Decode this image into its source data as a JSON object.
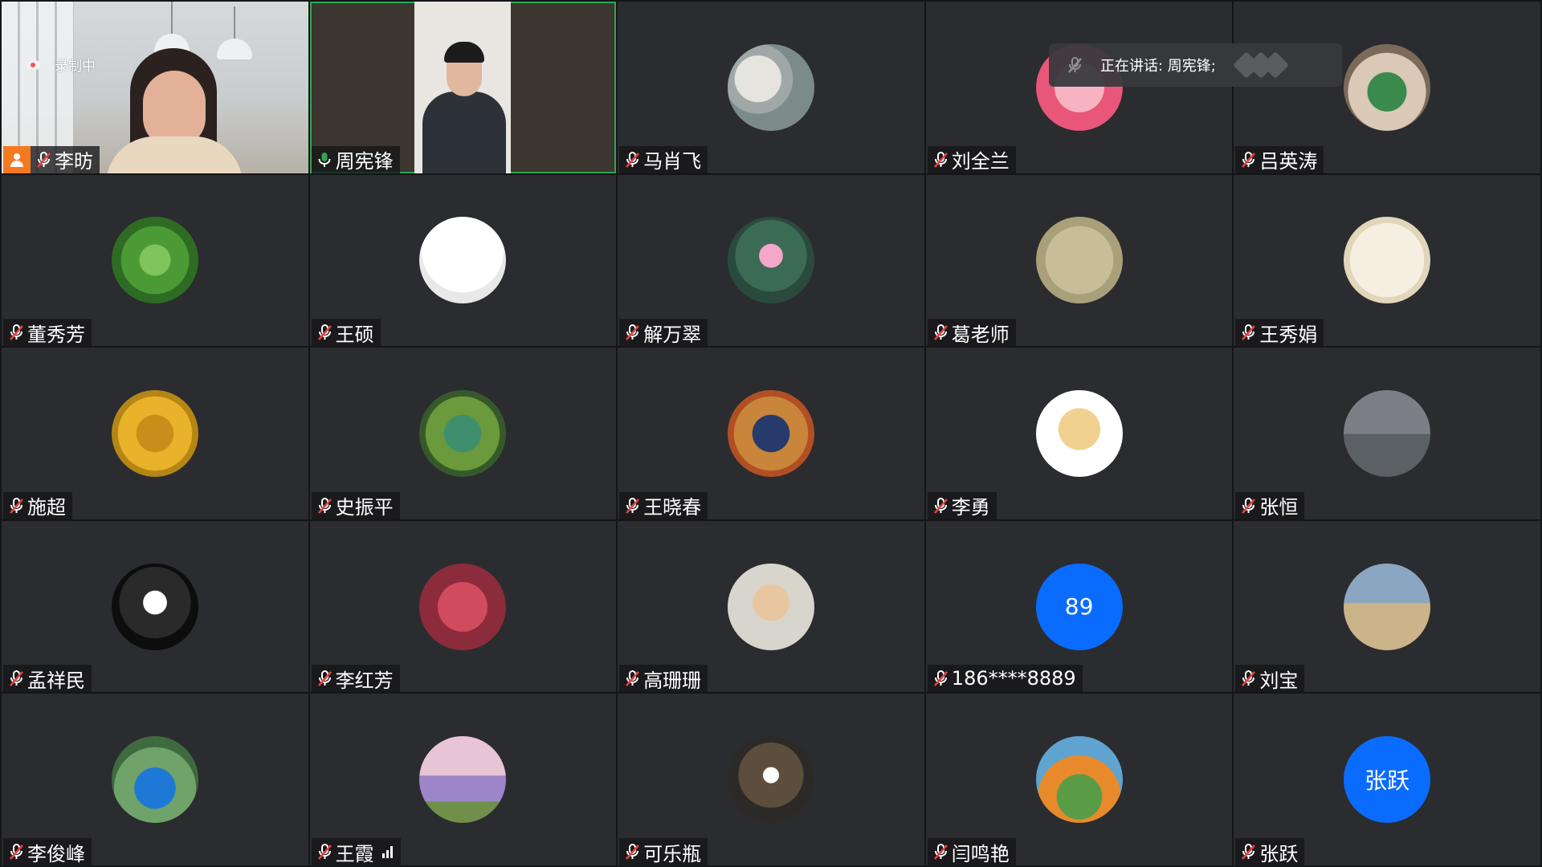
{
  "meeting": {
    "recording_label": "录制中",
    "speaking_label": "正在讲话: 周宪锋;",
    "colors": {
      "tile_bg": "#2b2c2f",
      "active_border": "#2ea652",
      "host_badge": "#f4791f",
      "mic_active": "#2ea652",
      "text_avatar": "#0a6cff"
    }
  },
  "participants": [
    {
      "name": "李昉",
      "kind": "video-office",
      "host": true,
      "muted": true
    },
    {
      "name": "周宪锋",
      "kind": "video-man",
      "speaking": true,
      "muted": false
    },
    {
      "name": "马肖飞",
      "kind": "avatar",
      "muted": true
    },
    {
      "name": "刘全兰",
      "kind": "avatar",
      "muted": true
    },
    {
      "name": "吕英涛",
      "kind": "avatar",
      "muted": true
    },
    {
      "name": "董秀芳",
      "kind": "avatar",
      "muted": true
    },
    {
      "name": "王硕",
      "kind": "avatar",
      "muted": true
    },
    {
      "name": "解万翠",
      "kind": "avatar",
      "muted": true
    },
    {
      "name": "葛老师",
      "kind": "avatar",
      "muted": true
    },
    {
      "name": "王秀娟",
      "kind": "avatar",
      "muted": true
    },
    {
      "name": "施超",
      "kind": "avatar",
      "muted": true
    },
    {
      "name": "史振平",
      "kind": "avatar",
      "muted": true
    },
    {
      "name": "王晓春",
      "kind": "avatar",
      "muted": true
    },
    {
      "name": "李勇",
      "kind": "avatar",
      "muted": true
    },
    {
      "name": "张恒",
      "kind": "avatar",
      "muted": true
    },
    {
      "name": "孟祥民",
      "kind": "avatar",
      "muted": true
    },
    {
      "name": "李红芳",
      "kind": "avatar",
      "muted": true
    },
    {
      "name": "高珊珊",
      "kind": "avatar",
      "muted": true
    },
    {
      "name": "186****8889",
      "kind": "text-avatar",
      "avatar_text": "89",
      "muted": true
    },
    {
      "name": "刘宝",
      "kind": "avatar",
      "muted": true
    },
    {
      "name": "李俊峰",
      "kind": "avatar",
      "muted": true
    },
    {
      "name": "王霞",
      "kind": "avatar",
      "muted": true,
      "signal": true
    },
    {
      "name": "可乐瓶",
      "kind": "avatar",
      "muted": true
    },
    {
      "name": "闫鸣艳",
      "kind": "avatar",
      "muted": true
    },
    {
      "name": "张跃",
      "kind": "text-avatar",
      "avatar_text": "张跃",
      "muted": true
    }
  ]
}
